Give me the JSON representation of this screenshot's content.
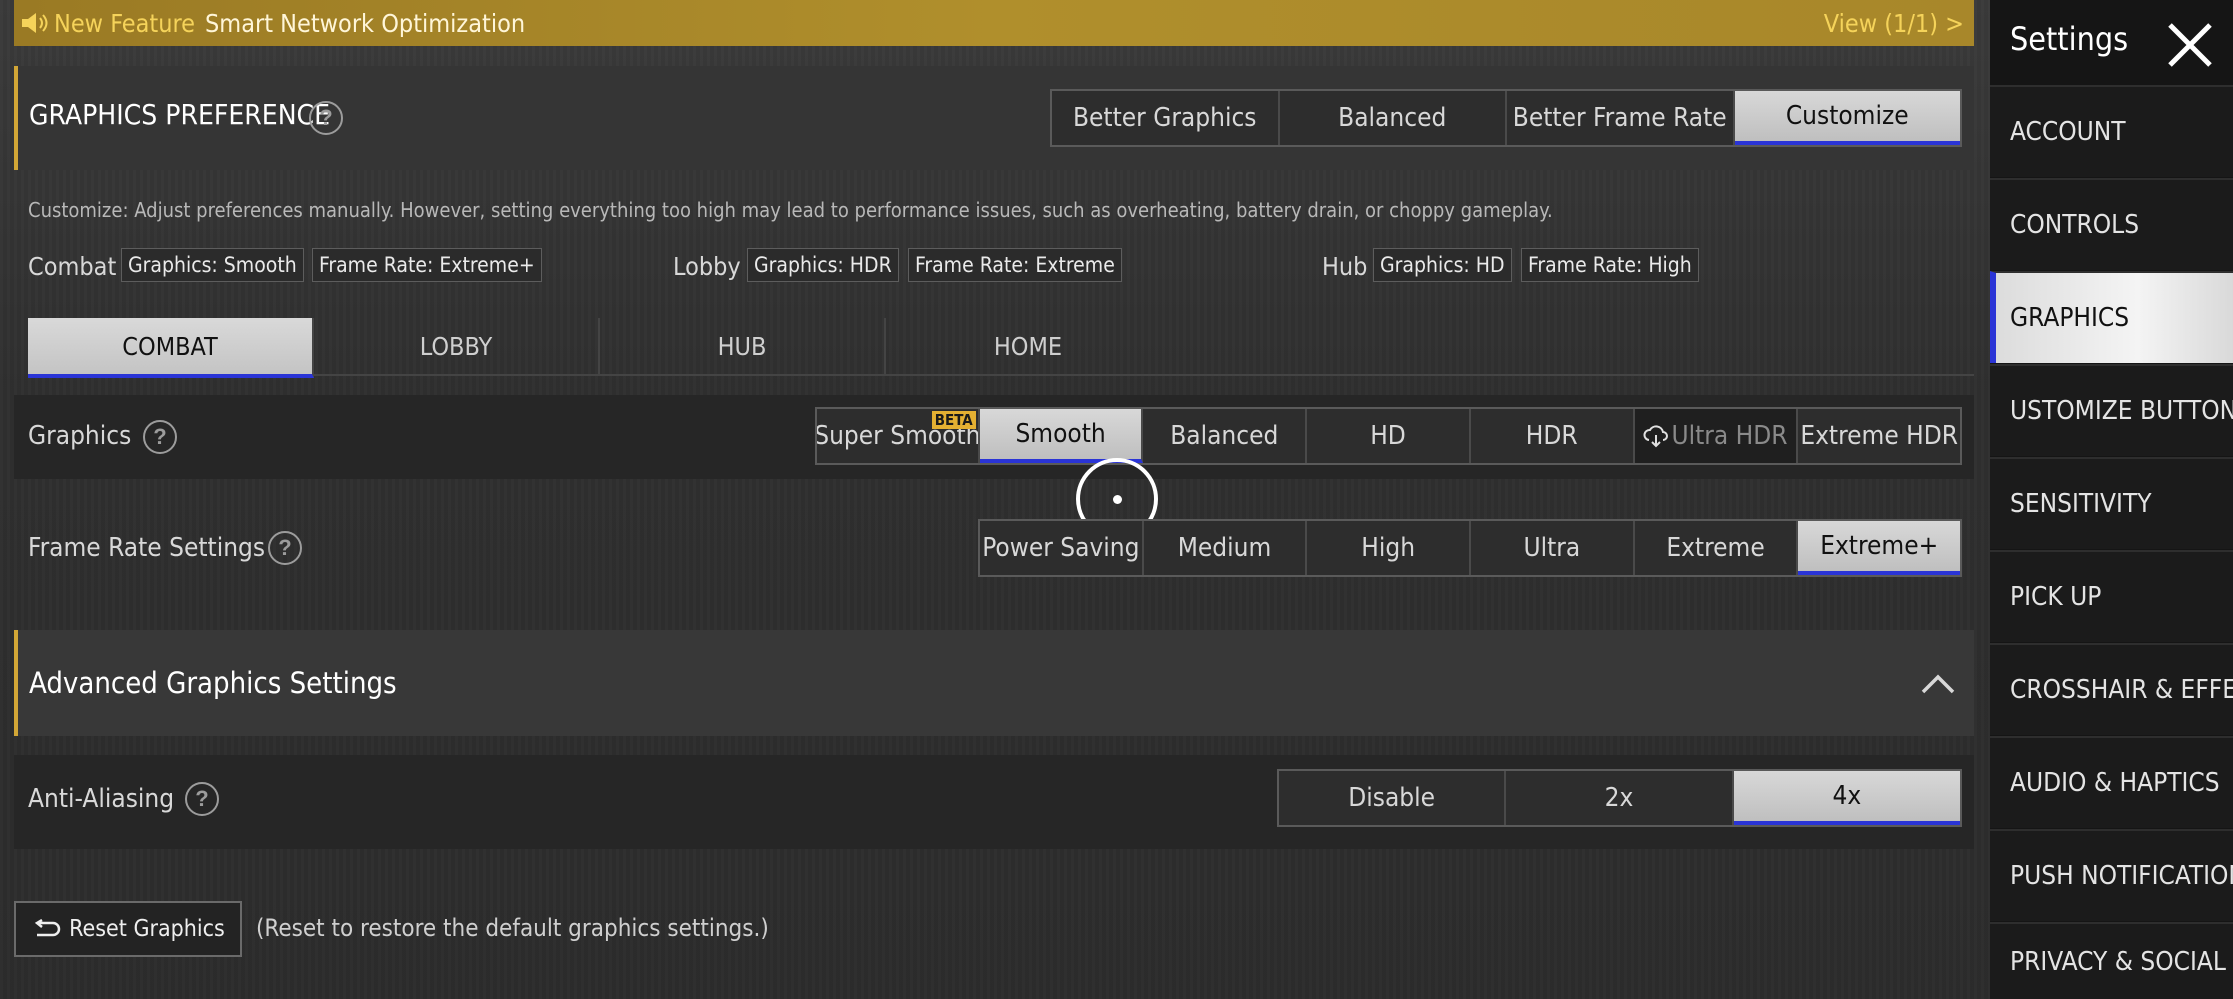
{
  "banner": {
    "feature_label": "New Feature",
    "text": "Smart Network Optimization",
    "view_label": "View (1/1) >"
  },
  "sidebar": {
    "title": "Settings",
    "items": [
      {
        "label": "ACCOUNT"
      },
      {
        "label": "CONTROLS"
      },
      {
        "label": "GRAPHICS"
      },
      {
        "label": "USTOMIZE BUTTONS"
      },
      {
        "label": "SENSITIVITY"
      },
      {
        "label": "PICK UP"
      },
      {
        "label": "CROSSHAIR & EFFEC"
      },
      {
        "label": "AUDIO & HAPTICS"
      },
      {
        "label": "PUSH NOTIFICATIONS"
      },
      {
        "label": "PRIVACY & SOCIAL"
      }
    ],
    "active_index": 2
  },
  "graphics_pref": {
    "title": "GRAPHICS PREFERENCE",
    "options": [
      "Better Graphics",
      "Balanced",
      "Better Frame Rate",
      "Customize"
    ],
    "selected": "Customize",
    "description": "Customize: Adjust preferences manually. However, setting everything too high may lead to performance issues, such as overheating, battery drain, or choppy gameplay."
  },
  "summary": {
    "combat": {
      "label": "Combat",
      "graphics": "Graphics: Smooth",
      "frame_rate": "Frame Rate: Extreme+"
    },
    "lobby": {
      "label": "Lobby",
      "graphics": "Graphics: HDR",
      "frame_rate": "Frame Rate: Extreme"
    },
    "hub": {
      "label": "Hub",
      "graphics": "Graphics: HD",
      "frame_rate": "Frame Rate: High"
    }
  },
  "mode_tabs": {
    "items": [
      "COMBAT",
      "LOBBY",
      "HUB",
      "HOME"
    ],
    "selected": "COMBAT"
  },
  "graphics": {
    "label": "Graphics",
    "options": [
      "Super Smooth",
      "Smooth",
      "Balanced",
      "HD",
      "HDR",
      "Ultra HDR",
      "Extreme HDR"
    ],
    "selected": "Smooth",
    "beta_badge": "BETA",
    "locked": "Ultra HDR"
  },
  "frame_rate": {
    "label": "Frame Rate Settings",
    "options": [
      "Power Saving",
      "Medium",
      "High",
      "Ultra",
      "Extreme",
      "Extreme+"
    ],
    "selected": "Extreme+"
  },
  "advanced": {
    "title": "Advanced Graphics Settings"
  },
  "anti_aliasing": {
    "label": "Anti-Aliasing",
    "options": [
      "Disable",
      "2x",
      "4x"
    ],
    "selected": "4x"
  },
  "reset": {
    "button_label": "Reset Graphics",
    "hint": "(Reset to restore the default graphics settings.)"
  },
  "colors": {
    "accent_blue": "#2a34d6",
    "gold": "#d2a636",
    "banner": "#a8872a"
  }
}
